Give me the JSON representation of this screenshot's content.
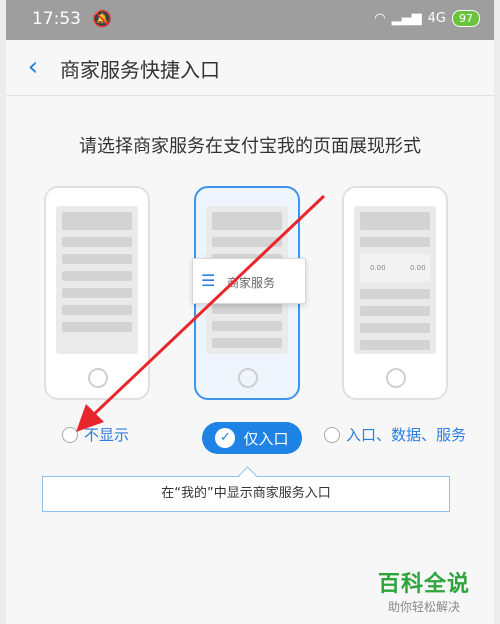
{
  "status": {
    "time": "17:53",
    "network": "4G",
    "battery": "97"
  },
  "nav": {
    "title": "商家服务快捷入口"
  },
  "prompt": "请选择商家服务在支付宝我的页面展现形式",
  "popup": {
    "label": "商家服务"
  },
  "options": {
    "hidden": "不显示",
    "entry_only": "仅入口",
    "full": "入口、数据、服务"
  },
  "description": "在“我的”中显示商家服务入口",
  "mini_phone": {
    "stat1": "0.00",
    "stat2": "0.00"
  },
  "watermark": {
    "title": "百科全说",
    "subtitle": "助你轻松解决"
  },
  "colors": {
    "accent": "#1f83e5",
    "arrow": "#e8262c"
  }
}
